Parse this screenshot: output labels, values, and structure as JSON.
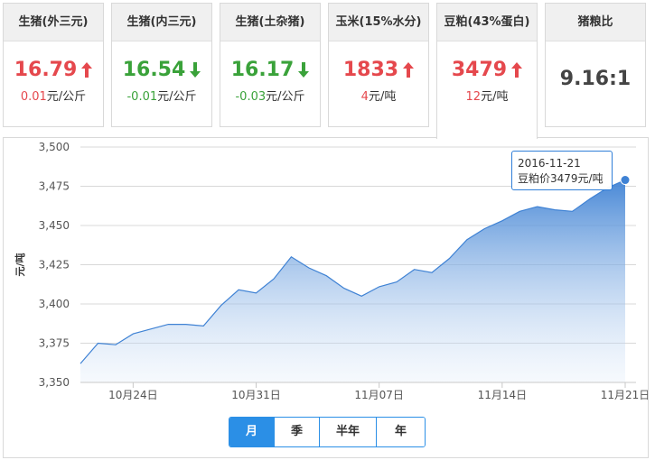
{
  "cards": [
    {
      "name": "生猪(外三元)",
      "price": "16.79",
      "direction": "up",
      "change": "0.01",
      "unit": "元/公斤"
    },
    {
      "name": "生猪(内三元)",
      "price": "16.54",
      "direction": "down",
      "change": "-0.01",
      "unit": "元/公斤"
    },
    {
      "name": "生猪(土杂猪)",
      "price": "16.17",
      "direction": "down",
      "change": "-0.03",
      "unit": "元/公斤"
    },
    {
      "name": "玉米(15%水分)",
      "price": "1833",
      "direction": "up",
      "change": "4",
      "unit": "元/吨"
    },
    {
      "name": "豆粕(43%蛋白)",
      "price": "3479",
      "direction": "up",
      "change": "12",
      "unit": "元/吨",
      "active": true
    },
    {
      "name": "猪粮比",
      "price": "9.16:1",
      "direction": "flat"
    }
  ],
  "colors": {
    "up": "#e5484d",
    "down": "#3aa23a",
    "accent": "#2b8fe6",
    "series": "#3f82d4"
  },
  "tooltip": {
    "date": "2016-11-21",
    "label": "豆粕价3479元/吨"
  },
  "period_tabs": [
    {
      "label": "月",
      "active": true
    },
    {
      "label": "季",
      "active": false
    },
    {
      "label": "半年",
      "active": false
    },
    {
      "label": "年",
      "active": false
    }
  ],
  "chart_data": {
    "type": "area",
    "ylabel": "元/吨",
    "ylim": [
      3350,
      3500
    ],
    "yticks": [
      3350,
      3375,
      3400,
      3425,
      3450,
      3475,
      3500
    ],
    "ytick_labels": [
      "3,350",
      "3,375",
      "3,400",
      "3,425",
      "3,450",
      "3,475",
      "3,500"
    ],
    "xtick_labels": [
      "10月24日",
      "10月31日",
      "11月07日",
      "11月14日",
      "11月21日"
    ],
    "xtick_dates": [
      "2016-10-24",
      "2016-10-31",
      "2016-11-07",
      "2016-11-14",
      "2016-11-21"
    ],
    "x": [
      "2016-10-21",
      "2016-10-22",
      "2016-10-23",
      "2016-10-24",
      "2016-10-25",
      "2016-10-26",
      "2016-10-27",
      "2016-10-28",
      "2016-10-29",
      "2016-10-30",
      "2016-10-31",
      "2016-11-01",
      "2016-11-02",
      "2016-11-03",
      "2016-11-04",
      "2016-11-05",
      "2016-11-06",
      "2016-11-07",
      "2016-11-08",
      "2016-11-09",
      "2016-11-10",
      "2016-11-11",
      "2016-11-12",
      "2016-11-13",
      "2016-11-14",
      "2016-11-15",
      "2016-11-16",
      "2016-11-17",
      "2016-11-18",
      "2016-11-19",
      "2016-11-20",
      "2016-11-21"
    ],
    "series": [
      {
        "values": [
          3362,
          3375,
          3374,
          3381,
          3384,
          3387,
          3387,
          3386,
          3399,
          3409,
          3407,
          3416,
          3430,
          3423,
          3418,
          3410,
          3405,
          3411,
          3414,
          3422,
          3420,
          3429,
          3441,
          3448,
          3453,
          3459,
          3462,
          3460,
          3459,
          3467,
          3474,
          3479
        ]
      }
    ],
    "grid": true,
    "legend": "none",
    "highlight_point": {
      "x": "2016-11-21",
      "y": 3479
    }
  }
}
